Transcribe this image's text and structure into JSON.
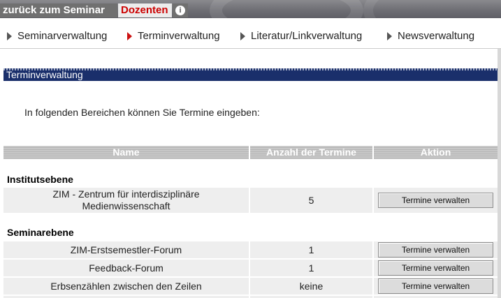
{
  "topbar": {
    "back_label": "zurück zum Seminar",
    "active_tab_label": "Dozenten",
    "info_glyph": "i"
  },
  "subnav": [
    {
      "label": "Seminarverwaltung",
      "active": false
    },
    {
      "label": "Terminverwaltung",
      "active": true
    },
    {
      "label": "Literatur/Linkverwaltung",
      "active": false
    },
    {
      "label": "Newsverwaltung",
      "active": false
    }
  ],
  "section": {
    "title": "Terminverwaltung",
    "intro": "In folgenden Bereichen können Sie Termine eingeben:"
  },
  "table": {
    "headers": [
      "Name",
      "Anzahl der Termine",
      "Aktion"
    ],
    "groups": [
      {
        "label": "Institutsebene",
        "rows": [
          {
            "name_line1": "ZIM - Zentrum für interdisziplinäre",
            "name_line2": "Medienwissenschaft",
            "count": "5",
            "action": "Termine verwalten"
          }
        ]
      },
      {
        "label": "Seminarebene",
        "rows": [
          {
            "name": "ZIM-Erstsemestler-Forum",
            "count": "1",
            "action": "Termine verwalten"
          },
          {
            "name": "Feedback-Forum",
            "count": "1",
            "action": "Termine verwalten"
          },
          {
            "name": "Erbsenzählen zwischen den Zeilen",
            "count": "keine",
            "action": "Termine verwalten"
          }
        ]
      }
    ]
  },
  "colors": {
    "header_bar": "#1a2f6b",
    "active_tab_text": "#cc0000",
    "row_bg": "#eeeeee"
  }
}
